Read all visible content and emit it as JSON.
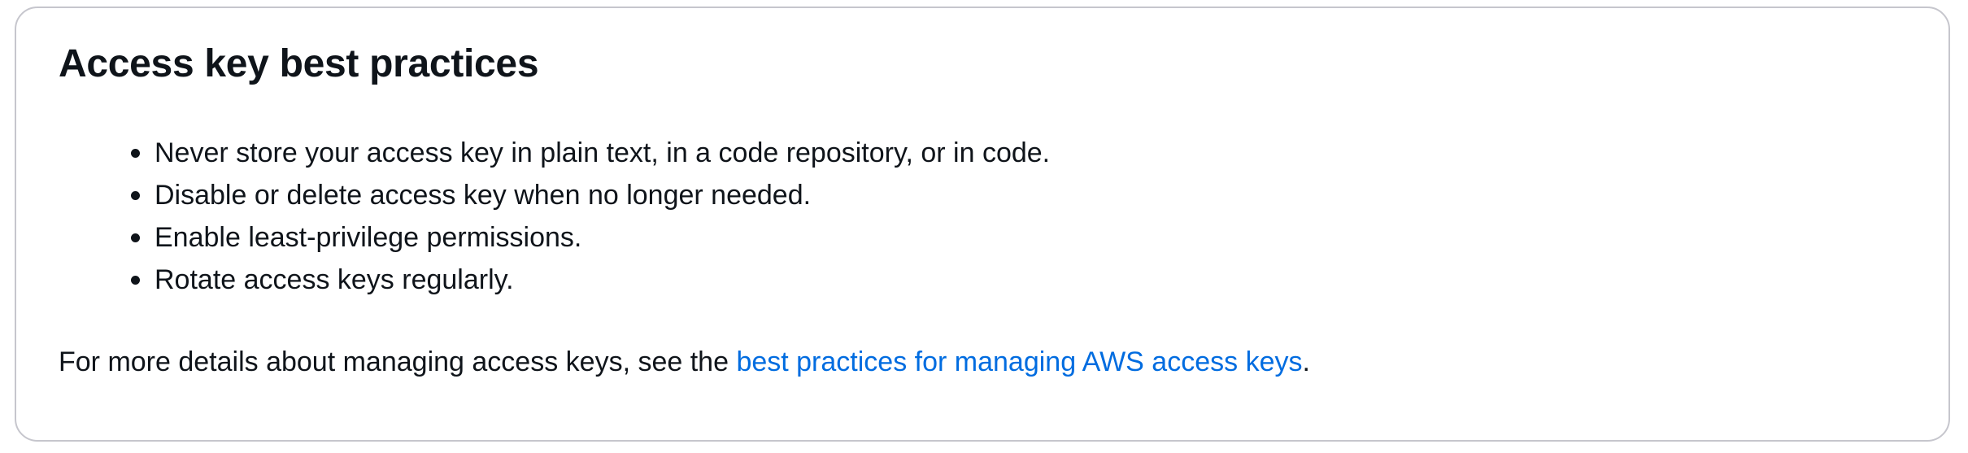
{
  "card": {
    "title": "Access key best practices",
    "bullets": [
      "Never store your access key in plain text, in a code repository, or in code.",
      "Disable or delete access key when no longer needed.",
      "Enable least-privilege permissions.",
      "Rotate access keys regularly."
    ],
    "footer": {
      "prefix": "For more details about managing access keys, see the ",
      "link_text": "best practices for managing AWS access keys",
      "suffix": "."
    }
  },
  "colors": {
    "text": "#0f141a",
    "link": "#006ce0",
    "border": "#c6c6cd",
    "background": "#ffffff"
  }
}
